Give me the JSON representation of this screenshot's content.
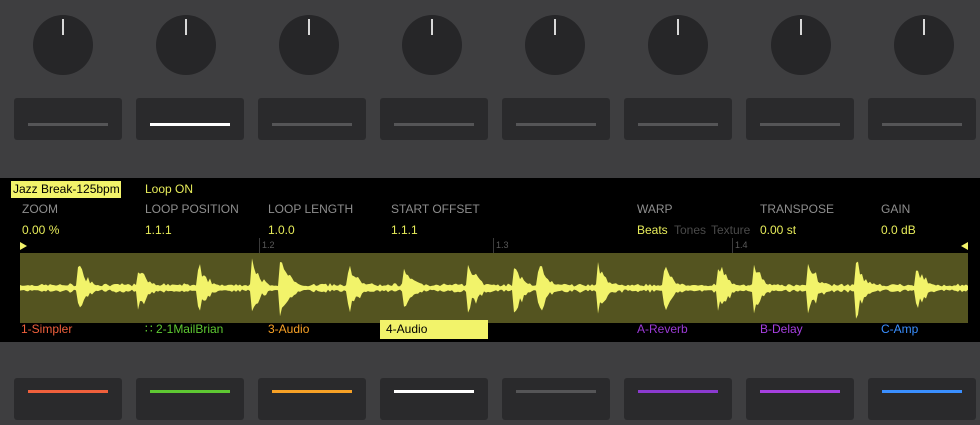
{
  "clip": {
    "name": "Jazz Break-125bpm",
    "loop_state": "Loop ON"
  },
  "parameters": [
    {
      "label": "ZOOM",
      "value": "0.00 %"
    },
    {
      "label": "LOOP POSITION",
      "value": "1.1.1"
    },
    {
      "label": "LOOP LENGTH",
      "value": "1.0.0"
    },
    {
      "label": "START OFFSET",
      "value": "1.1.1"
    },
    {
      "label": "WARP",
      "value_selected": "Beats",
      "value_options": [
        "Tones",
        "Texture"
      ]
    },
    {
      "label": "TRANSPOSE",
      "value": "0.00 st"
    },
    {
      "label": "GAIN",
      "value": "0.0 dB"
    }
  ],
  "markers": [
    "1.2",
    "1.3",
    "1.4"
  ],
  "tracks": [
    {
      "name": "1-Simpler",
      "color": "#f0603c"
    },
    {
      "name": "2-1MailBrian",
      "icon": "grid-dots-icon",
      "color": "#5ec832"
    },
    {
      "name": "3-Audio",
      "color": "#f7a126"
    },
    {
      "name": "4-Audio",
      "color": "#f2f36a",
      "selected": true
    },
    {
      "name": "A-Reverb",
      "color": "#9b3ad6"
    },
    {
      "name": "B-Delay",
      "color": "#a640e0"
    },
    {
      "name": "C-Amp",
      "color": "#3a8fff"
    }
  ],
  "colors": {
    "accent": "#f2f36a",
    "pad_bar_white": "#ffffff",
    "pad_bar_default": "#555557",
    "track_colors_bottom": [
      "#f0603c",
      "#5ec832",
      "#f7a126",
      "#ffffff",
      "#555557",
      "#8b3ad0",
      "#a640e0",
      "#3a8fff"
    ]
  },
  "icons": [
    "grid-dots-icon",
    "loop-start-flag-icon",
    "loop-end-flag-icon"
  ]
}
